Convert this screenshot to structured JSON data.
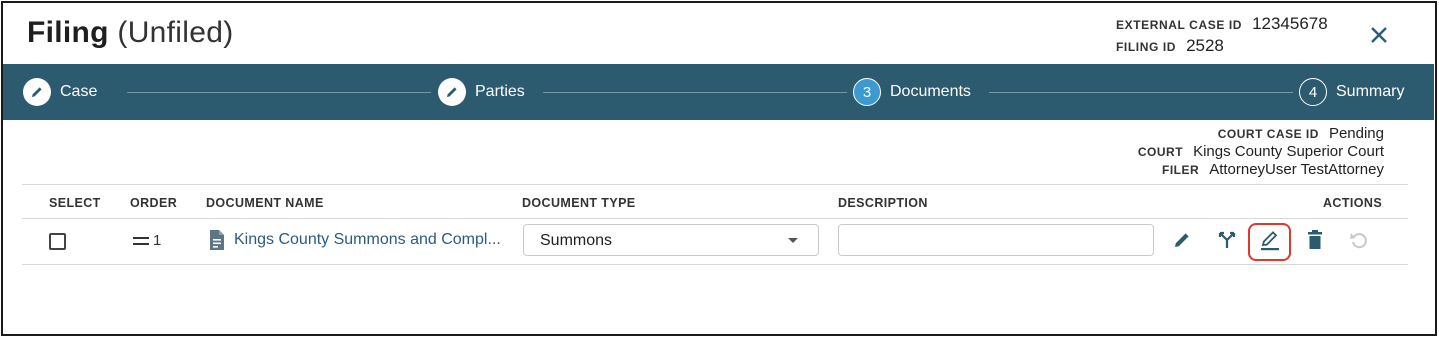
{
  "header": {
    "title": "Filing",
    "subtitle": "(Unfiled)",
    "external_case_id_label": "EXTERNAL CASE ID",
    "external_case_id": "12345678",
    "filing_id_label": "FILING ID",
    "filing_id": "2528"
  },
  "steps": [
    {
      "label": "Case",
      "state": "done",
      "icon": "pencil-icon"
    },
    {
      "label": "Parties",
      "state": "done",
      "icon": "pencil-icon"
    },
    {
      "label": "Documents",
      "state": "active",
      "number": "3"
    },
    {
      "label": "Summary",
      "state": "todo",
      "number": "4"
    }
  ],
  "meta": {
    "court_case_id_label": "COURT CASE ID",
    "court_case_id": "Pending",
    "court_label": "COURT",
    "court": "Kings County Superior Court",
    "filer_label": "FILER",
    "filer": "AttorneyUser TestAttorney"
  },
  "table": {
    "columns": {
      "select": "SELECT",
      "order": "ORDER",
      "document_name": "DOCUMENT NAME",
      "document_type": "DOCUMENT TYPE",
      "description": "DESCRIPTION",
      "actions": "ACTIONS"
    },
    "rows": [
      {
        "order": "1",
        "document_name": "Kings County Summons and Compl...",
        "document_type": "Summons",
        "description": "",
        "actions": [
          "edit-icon",
          "split-icon",
          "sign-icon",
          "delete-icon",
          "undo-icon"
        ]
      }
    ]
  },
  "colors": {
    "stepper_bg": "#2c5a6e",
    "active_step": "#3d9ad1",
    "link": "#2b5c80",
    "highlight": "#e0392b"
  }
}
